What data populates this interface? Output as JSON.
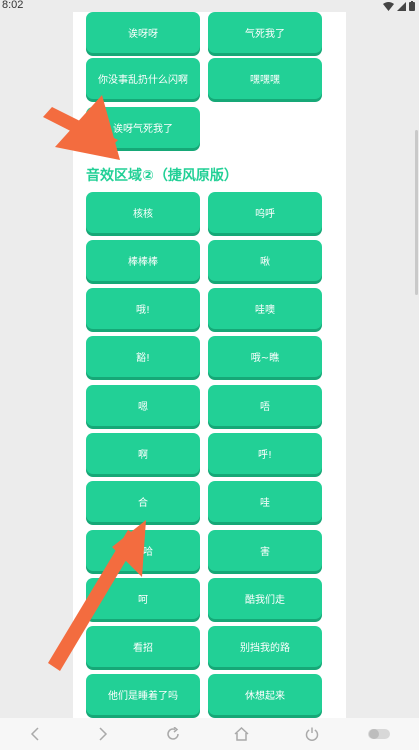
{
  "status_bar": {
    "time": "8:02"
  },
  "section1": {
    "buttons": [
      "诶呀呀",
      "气死我了",
      "你没事乱扔什么闪啊",
      "嘿嘿嘿",
      "诶呀气死我了"
    ]
  },
  "section2": {
    "title": "音效区域②（捷风原版）",
    "buttons": [
      "核核",
      "呜呼",
      "棒棒棒",
      "啾",
      "哦!",
      "哇噢",
      "豁!",
      "哦~瞧",
      "嗯",
      "唔",
      "啊",
      "呼!",
      "合",
      "哇",
      "哈哈",
      "害",
      "呵",
      "酷我们走",
      "看招",
      "别挡我的路",
      "他们是睡着了吗",
      "休想起来"
    ]
  },
  "colors": {
    "accent": "#22d096",
    "accent_shadow": "#16a877",
    "arrow": "#f36c3f"
  },
  "nav_bar": {
    "icons": [
      "back-icon",
      "forward-icon",
      "refresh-icon",
      "home-icon",
      "power-icon",
      "toggle-icon"
    ]
  }
}
